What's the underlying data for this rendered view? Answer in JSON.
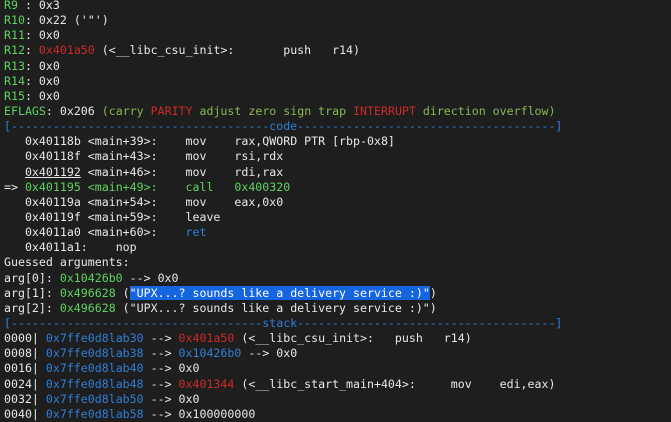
{
  "colors": {
    "background": "#1e1e1e",
    "text": "#e8e8e8",
    "register_name": "#5fd35f",
    "code_address": "#cc2a2a",
    "stack_address": "#2f7fd6",
    "selection": "#1565e0"
  },
  "registers": [
    {
      "name": "R9",
      "sep": " : ",
      "parts": [
        {
          "c": "w",
          "t": "0x3"
        }
      ]
    },
    {
      "name": "R10",
      "sep": ": ",
      "parts": [
        {
          "c": "w",
          "t": "0x22 ('\"')"
        }
      ]
    },
    {
      "name": "R11",
      "sep": ": ",
      "parts": [
        {
          "c": "w",
          "t": "0x0"
        }
      ]
    },
    {
      "name": "R12",
      "sep": ": ",
      "parts": [
        {
          "c": "r",
          "t": "0x401a50"
        },
        {
          "c": "w",
          "t": " (<__libc_csu_init>:       push   r14)"
        }
      ]
    },
    {
      "name": "R13",
      "sep": ": ",
      "parts": [
        {
          "c": "w",
          "t": "0x0"
        }
      ]
    },
    {
      "name": "R14",
      "sep": ": ",
      "parts": [
        {
          "c": "w",
          "t": "0x0"
        }
      ]
    },
    {
      "name": "R15",
      "sep": ": ",
      "parts": [
        {
          "c": "w",
          "t": "0x0"
        }
      ]
    },
    {
      "name": "EFLAGS",
      "sep": ": ",
      "parts": [
        {
          "c": "w",
          "t": "0x206 "
        },
        {
          "c": "gd",
          "t": "(carry "
        },
        {
          "c": "r",
          "t": "PARITY"
        },
        {
          "c": "gd",
          "t": " adjust zero sign trap "
        },
        {
          "c": "r",
          "t": "INTERRUPT"
        },
        {
          "c": "gd",
          "t": " direction overflow)"
        }
      ]
    }
  ],
  "code_header": "[-------------------------------------code-------------------------------------]",
  "code": [
    {
      "marker": "   ",
      "addr": "0x40118b",
      "ul": false,
      "sym": " <main+39>:",
      "ins": "    mov    rax,QWORD PTR [rbp-0x8]",
      "cur": false
    },
    {
      "marker": "   ",
      "addr": "0x40118f",
      "ul": false,
      "sym": " <main+43>:",
      "ins": "    mov    rsi,rdx",
      "cur": false
    },
    {
      "marker": "   ",
      "addr": "0x401192",
      "ul": true,
      "sym": " <main+46>:",
      "ins": "    mov    rdi,rax",
      "cur": false
    },
    {
      "marker": "=> ",
      "addr": "0x401195",
      "ul": false,
      "sym": " <main+49>:",
      "ins": "    call   0x400320",
      "cur": true
    },
    {
      "marker": "   ",
      "addr": "0x40119a",
      "ul": false,
      "sym": " <main+54>:",
      "ins": "    mov    eax,0x0",
      "cur": false
    },
    {
      "marker": "   ",
      "addr": "0x40119f",
      "ul": false,
      "sym": " <main+59>:",
      "ins": "    leave",
      "cur": false
    },
    {
      "marker": "   ",
      "addr": "0x4011a0",
      "ul": false,
      "sym": " <main+60>:",
      "ins": "    ret",
      "ret": true,
      "cur": false
    },
    {
      "marker": "   ",
      "addr": "0x4011a1",
      "ul": false,
      "sym": ":",
      "ins": "    nop",
      "cur": false
    }
  ],
  "guessed_title": "Guessed arguments:",
  "args": [
    {
      "label": "arg[0]: ",
      "addr": "0x10426b0",
      "rest": " --> 0x0",
      "hl": false
    },
    {
      "label": "arg[1]: ",
      "addr": "0x496628",
      "rest": " (\"UPX...? sounds like a delivery service :)\")",
      "hl": true
    },
    {
      "label": "arg[2]: ",
      "addr": "0x496628",
      "rest": " (\"UPX...? sounds like a delivery service :)\")",
      "hl": false
    }
  ],
  "stack_header": "[------------------------------------stack-------------------------------------]",
  "stack": [
    {
      "off": "0000|",
      "addr": "0x7ffe0d8lab30",
      "parts": [
        {
          "c": "w",
          "t": " --> "
        },
        {
          "c": "r",
          "t": "0x401a50"
        },
        {
          "c": "w",
          "t": " (<__libc_csu_init>:   push   r14)"
        }
      ]
    },
    {
      "off": "0008|",
      "addr": "0x7ffe0d8lab38",
      "parts": [
        {
          "c": "w",
          "t": " --> "
        },
        {
          "c": "b",
          "t": "0x10426b0"
        },
        {
          "c": "w",
          "t": " --> 0x0"
        }
      ]
    },
    {
      "off": "0016|",
      "addr": "0x7ffe0d8lab40",
      "parts": [
        {
          "c": "w",
          "t": " --> 0x0"
        }
      ]
    },
    {
      "off": "0024|",
      "addr": "0x7ffe0d8lab48",
      "parts": [
        {
          "c": "w",
          "t": " --> "
        },
        {
          "c": "r",
          "t": "0x401344"
        },
        {
          "c": "w",
          "t": " (<__libc_start_main+404>:     mov    edi,eax)"
        }
      ]
    },
    {
      "off": "0032|",
      "addr": "0x7ffe0d8lab50",
      "parts": [
        {
          "c": "w",
          "t": " --> 0x0"
        }
      ]
    },
    {
      "off": "0040|",
      "addr": "0x7ffe0d8lab58",
      "parts": [
        {
          "c": "w",
          "t": " --> 0x100000000"
        }
      ]
    }
  ]
}
